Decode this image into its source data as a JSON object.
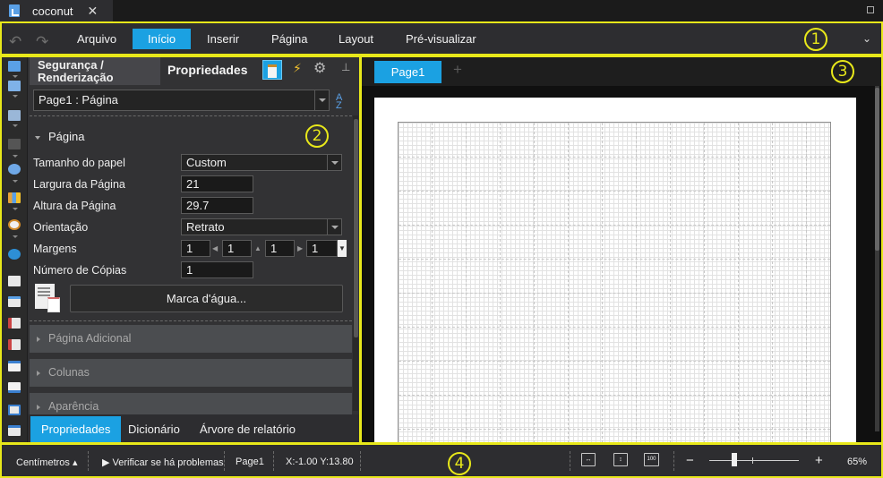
{
  "document_tab": {
    "title": "coconut",
    "close": "✕"
  },
  "ribbon": {
    "menu": [
      {
        "label": "Arquivo"
      },
      {
        "label": "Início",
        "active": true
      },
      {
        "label": "Inserir"
      },
      {
        "label": "Página"
      },
      {
        "label": "Layout"
      },
      {
        "label": "Pré-visualizar"
      }
    ]
  },
  "annotations": {
    "badge1": "1",
    "badge2": "2",
    "badge3": "3",
    "badge4": "4"
  },
  "properties_panel": {
    "tab_security_line1": "Segurança /",
    "tab_security_line2": "Renderização",
    "tab_properties": "Propriedades",
    "object_selector": "Page1 : Página",
    "section_title": "Página",
    "fields": {
      "paper_size_label": "Tamanho do papel",
      "paper_size_value": "Custom",
      "page_width_label": "Largura da Página",
      "page_width_value": "21",
      "page_height_label": "Altura da Página",
      "page_height_value": "29.7",
      "orientation_label": "Orientação",
      "orientation_value": "Retrato",
      "margins_label": "Margens",
      "margin_left": "1",
      "margin_right": "1",
      "margin_top": "1",
      "margin_bottom": "1",
      "copies_label": "Número de Cópias",
      "copies_value": "1"
    },
    "watermark_button": "Marca d'água...",
    "collapsed_sections": [
      "Página Adicional",
      "Colunas",
      "Aparência"
    ],
    "bottom_tabs": [
      {
        "label": "Propriedades",
        "active": true
      },
      {
        "label": "Dicionário"
      },
      {
        "label": "Árvore de relatório"
      }
    ]
  },
  "designer": {
    "page_tab": "Page1",
    "add_tab": "+"
  },
  "status_bar": {
    "units": "Centímetros",
    "check_issues": "Verificar se há problemas",
    "page": "Page1",
    "coords": "X:-1.00 Y:13.80",
    "zoom_minus": "−",
    "zoom_plus": "+",
    "zoom_100": "100",
    "zoom_level": "65%"
  },
  "colors": {
    "accent": "#1ba1e2",
    "annotation": "#e8e81a"
  },
  "icons": [
    "undo-icon",
    "redo-icon",
    "chevron-down-icon",
    "properties-icon",
    "lightning-icon",
    "gear-icon",
    "pin-icon",
    "sort-az-icon",
    "page-icon",
    "fit-width-icon",
    "fit-height-icon"
  ]
}
